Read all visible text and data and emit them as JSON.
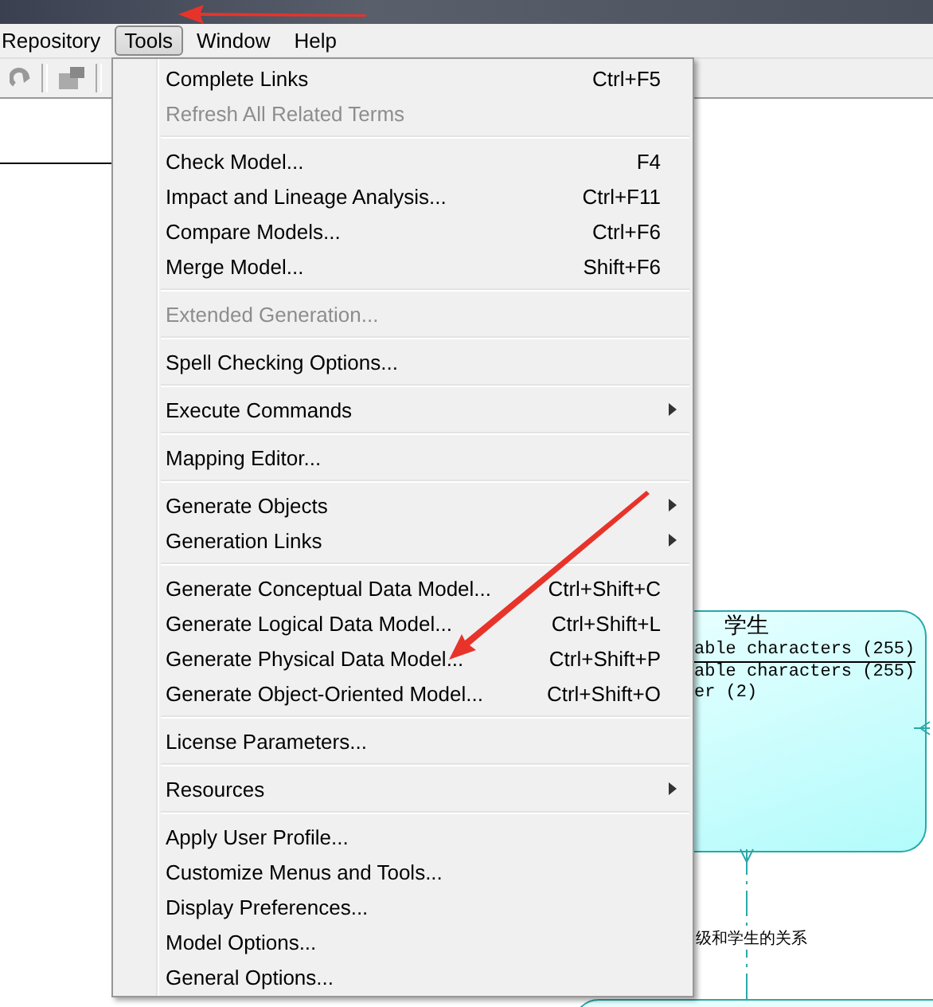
{
  "menubar": [
    {
      "label": "Repository",
      "selected": false
    },
    {
      "label": "Tools",
      "selected": true
    },
    {
      "label": "Window",
      "selected": false
    },
    {
      "label": "Help",
      "selected": false
    }
  ],
  "menu_groups": [
    [
      {
        "label": "Complete Links",
        "shortcut": "Ctrl+F5",
        "disabled": false,
        "submenu": false
      },
      {
        "label": "Refresh All Related Terms",
        "disabled": true,
        "submenu": false
      }
    ],
    [
      {
        "label": "Check Model...",
        "shortcut": "F4",
        "disabled": false,
        "submenu": false
      },
      {
        "label": "Impact and Lineage Analysis...",
        "shortcut": "Ctrl+F11",
        "disabled": false,
        "submenu": false
      },
      {
        "label": "Compare Models...",
        "shortcut": "Ctrl+F6",
        "disabled": false,
        "submenu": false
      },
      {
        "label": "Merge Model...",
        "shortcut": "Shift+F6",
        "disabled": false,
        "submenu": false
      }
    ],
    [
      {
        "label": "Extended Generation...",
        "disabled": true,
        "submenu": false
      }
    ],
    [
      {
        "label": "Spell Checking Options...",
        "disabled": false,
        "submenu": false
      }
    ],
    [
      {
        "label": "Execute Commands",
        "disabled": false,
        "submenu": true
      }
    ],
    [
      {
        "label": "Mapping Editor...",
        "disabled": false,
        "submenu": false
      }
    ],
    [
      {
        "label": "Generate Objects",
        "disabled": false,
        "submenu": true
      },
      {
        "label": "Generation Links",
        "disabled": false,
        "submenu": true
      }
    ],
    [
      {
        "label": "Generate Conceptual Data Model...",
        "shortcut": "Ctrl+Shift+C",
        "disabled": false,
        "submenu": false
      },
      {
        "label": "Generate Logical Data Model...",
        "shortcut": "Ctrl+Shift+L",
        "disabled": false,
        "submenu": false
      },
      {
        "label": "Generate Physical Data Model...",
        "shortcut": "Ctrl+Shift+P",
        "disabled": false,
        "submenu": false
      },
      {
        "label": "Generate Object-Oriented Model...",
        "shortcut": "Ctrl+Shift+O",
        "disabled": false,
        "submenu": false
      }
    ],
    [
      {
        "label": "License Parameters...",
        "disabled": false,
        "submenu": false
      }
    ],
    [
      {
        "label": "Resources",
        "disabled": false,
        "submenu": true
      }
    ],
    [
      {
        "label": "Apply User Profile...",
        "disabled": false,
        "submenu": false
      },
      {
        "label": "Customize Menus and Tools...",
        "disabled": false,
        "submenu": false
      },
      {
        "label": "Display Preferences...",
        "disabled": false,
        "submenu": false
      },
      {
        "label": "Model Options...",
        "disabled": false,
        "submenu": false
      },
      {
        "label": "General Options...",
        "disabled": false,
        "submenu": false
      }
    ]
  ],
  "entity": {
    "title": "学生",
    "attributes": [
      {
        "text": "able characters (255)",
        "identifier": true
      },
      {
        "text": "able characters (255)",
        "identifier": false
      },
      {
        "text": "er (2)",
        "identifier": false
      }
    ]
  },
  "relationship": {
    "label": "级和学生的关系"
  }
}
